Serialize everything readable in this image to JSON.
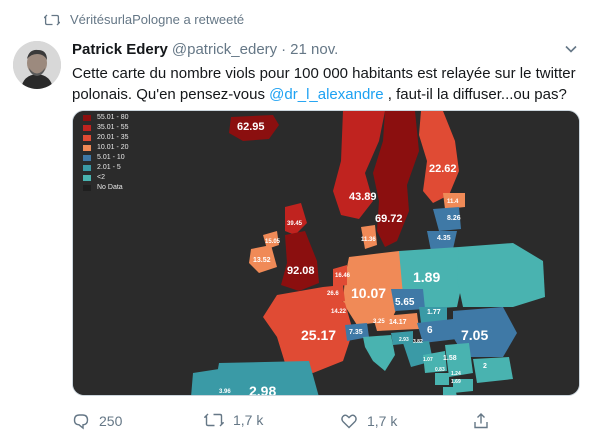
{
  "retweet_context": "VéritésurlaPologne a retweeté",
  "tweet": {
    "author_name": "Patrick Edery",
    "handle": "@patrick_edery",
    "separator": "·",
    "date": "21 nov.",
    "text_before": "Cette carte du nombre viols pour 100 000 habitants est relayée sur le twitter polonais. Qu'en pensez-vous ",
    "mention": "@dr_l_alexandre",
    "text_after": " , faut-il la diffuser...ou pas?"
  },
  "map": {
    "legend": [
      {
        "label": "55.01 - 80",
        "color": "#8b0f0f"
      },
      {
        "label": "35.01 - 55",
        "color": "#c0231f"
      },
      {
        "label": "20.01 - 35",
        "color": "#e04b34"
      },
      {
        "label": "10.01 - 20",
        "color": "#f08a57"
      },
      {
        "label": "5.01 - 10",
        "color": "#3f79a6"
      },
      {
        "label": "2.01 - 5",
        "color": "#3a9aa6"
      },
      {
        "label": "<2",
        "color": "#49b3b0"
      },
      {
        "label": "No Data",
        "color": "#1f1f1f"
      }
    ],
    "labels": {
      "iceland": "62.95",
      "finland": "22.62",
      "norway": "43.89",
      "sweden": "69.72",
      "russia_north": "11.4",
      "latvia": "8.26",
      "lithuania": "4.35",
      "scotland": "39.45",
      "northern_ireland": "15.05",
      "ireland": "13.52",
      "england": "92.08",
      "denmark": "11.36",
      "poland": "1.89",
      "germany": "10.07",
      "netherlands": "16.46",
      "belgium": "26.6",
      "czechia": "5.65",
      "ukraine": "1.77",
      "france": "25.17",
      "luxembourg": "14.22",
      "switzerland": "7.35",
      "austria": "14.17",
      "slovakia": "3.25",
      "hungary": "6",
      "romania": "7.05",
      "slovenia": "3.82",
      "croatia": "2.93",
      "serbia": "1.58",
      "bosnia": "1.07",
      "bulgaria": "2",
      "montenegro": "0.83",
      "macedonia": "1.24",
      "albania": "1.69",
      "spain": "2.98",
      "portugal": "3.96"
    }
  },
  "actions": {
    "reply_count": "250",
    "retweet_count": "1,7 k",
    "like_count": "1,7 k"
  },
  "colors": {
    "accent": "#1da1f2",
    "muted": "#657786"
  }
}
